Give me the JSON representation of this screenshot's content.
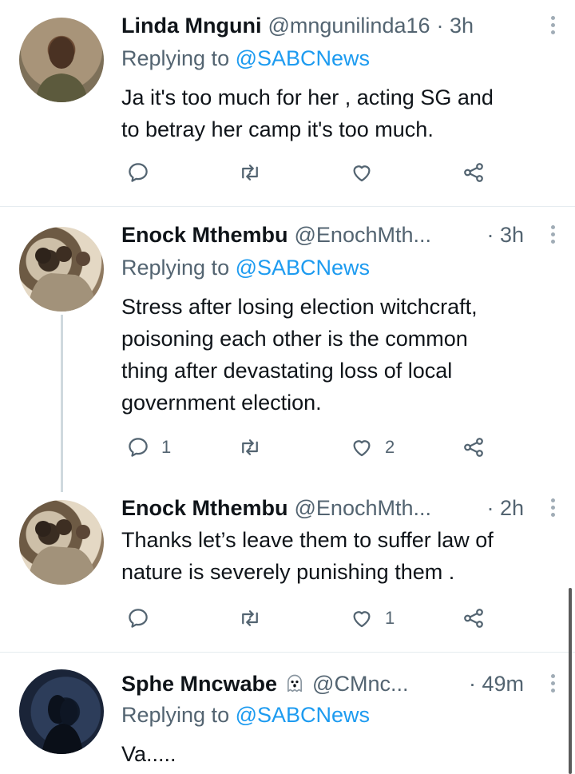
{
  "tweets": [
    {
      "name": "Linda Mnguni",
      "handle": "@mngunilinda16",
      "time": "· 3h",
      "replying_prefix": "Replying to ",
      "replying_to": "@SABCNews",
      "text_lines": [
        "Ja it's too much for her , acting SG and",
        "to betray her camp it's too much."
      ]
    },
    {
      "name": "Enock Mthembu",
      "handle": "@EnochMth...",
      "time": "· 3h",
      "replying_prefix": "Replying to ",
      "replying_to": "@SABCNews",
      "text_lines": [
        "Stress after losing election witchcraft,",
        "poisoning each other is the common",
        "thing after devastating loss of local",
        "government election."
      ],
      "reply_count": "1",
      "like_count": "2"
    },
    {
      "name": "Enock Mthembu",
      "handle": "@EnochMth...",
      "time": "· 2h",
      "text_lines": [
        "Thanks let’s leave them to suffer law of",
        "nature is severely punishing them ."
      ],
      "like_count": "1"
    },
    {
      "name": "Sphe Mncwabe",
      "handle": "@CMnc...",
      "time": "· 49m",
      "replying_prefix": "Replying to ",
      "replying_to": "@SABCNews",
      "text_lines": [
        "Va....."
      ]
    }
  ],
  "icons": {
    "reply": "reply-icon",
    "retweet": "retweet-icon",
    "like": "heart-icon",
    "share": "share-icon",
    "more": "more-options-icon",
    "emoji": "ghost-emoji-icon"
  },
  "colors": {
    "link": "#1d9bf0",
    "secondary_text": "#536471",
    "primary_text": "#0f1419",
    "icon": "#536471"
  }
}
